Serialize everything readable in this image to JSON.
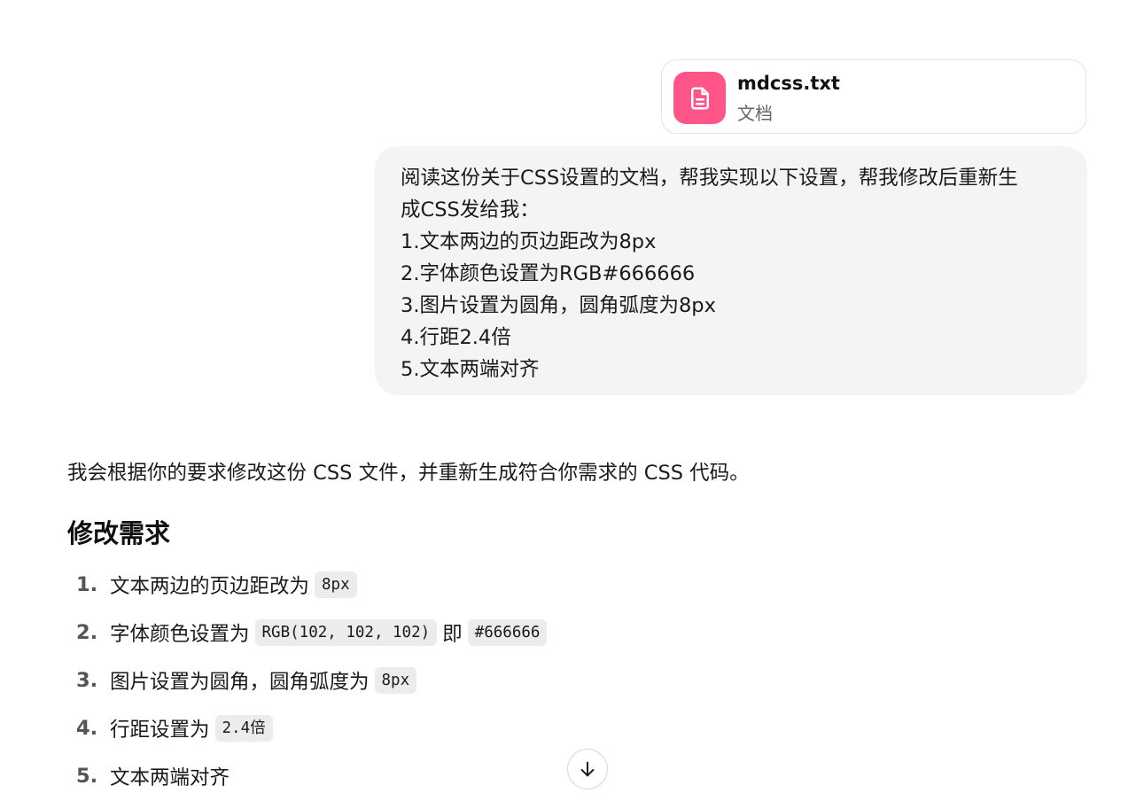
{
  "attachment": {
    "name": "mdcss.txt",
    "type": "文档",
    "icon": "document-icon",
    "icon_bg": "#ff5588"
  },
  "user_message": {
    "lines": [
      "阅读这份关于CSS设置的文档，帮我实现以下设置，帮我修改后重新生",
      "成CSS发给我：",
      "1.文本两边的页边距改为8px",
      "2.字体颜色设置为RGB#666666",
      "3.图片设置为圆角，圆角弧度为8px",
      "4.行距2.4倍",
      "5.文本两端对齐"
    ]
  },
  "assistant": {
    "intro": "我会根据你的要求修改这份 CSS 文件，并重新生成符合你需求的 CSS 代码。",
    "heading": "修改需求",
    "requirements": [
      {
        "num": "1.",
        "text": "文本两边的页边距改为",
        "code": "8px"
      },
      {
        "num": "2.",
        "text": "字体颜色设置为",
        "code": "RGB(102, 102, 102)",
        "joiner": "即",
        "code2": "#666666"
      },
      {
        "num": "3.",
        "text": "图片设置为圆角，圆角弧度为",
        "code": "8px"
      },
      {
        "num": "4.",
        "text": "行距设置为",
        "code": "2.4倍"
      },
      {
        "num": "5.",
        "text": "文本两端对齐"
      }
    ]
  },
  "controls": {
    "scroll_down_icon": "arrow-down-icon"
  }
}
